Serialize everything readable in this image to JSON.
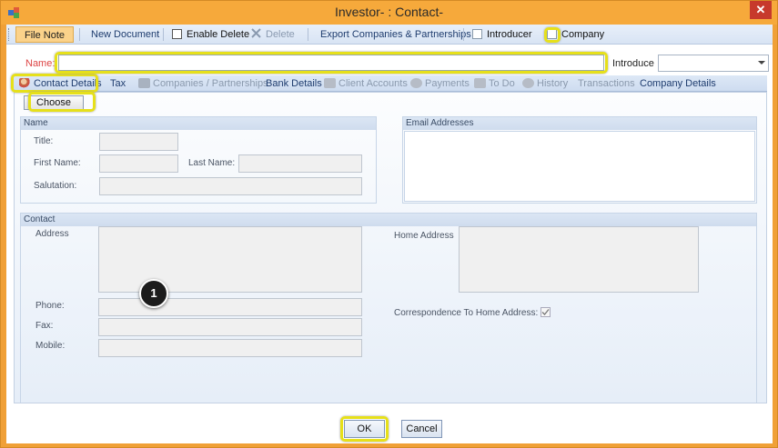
{
  "window": {
    "title": "Investor- : Contact-",
    "close_symbol": "✕"
  },
  "toolbar": {
    "file_note": "File Note",
    "new_document": "New Document",
    "enable_delete": "Enable Delete",
    "delete": "Delete",
    "export": "Export Companies & Partnerships",
    "introducer": "Introducer",
    "company": "Company"
  },
  "header": {
    "name_label": "Name:",
    "name_value": "",
    "introducer_label": "Introduce",
    "introducer_value": ""
  },
  "tabs": [
    "Contact Details",
    "Tax",
    "Companies / Partnerships",
    "Bank Details",
    "Client Accounts",
    "Payments",
    "To Do",
    "History",
    "Transactions",
    "Company Details"
  ],
  "panel": {
    "choose_label": "Choose",
    "name_group": {
      "title": "Name",
      "title_label": "Title:",
      "first_name_label": "First Name:",
      "last_name_label": "Last Name:",
      "salutation_label": "Salutation:"
    },
    "email_group": {
      "title": "Email Addresses"
    },
    "contact_group": {
      "title": "Contact",
      "address_label": "Address",
      "home_address_label": "Home Address",
      "phone_label": "Phone:",
      "fax_label": "Fax:",
      "mobile_label": "Mobile:",
      "correspondence_label": "Correspondence To Home Address:",
      "correspondence_checked": true
    }
  },
  "marker": "1",
  "footer": {
    "ok": "OK",
    "cancel": "Cancel"
  },
  "colors": {
    "titlebar": "#f6a93b",
    "highlight": "#e6e01a",
    "accent": "#1e3c6e"
  }
}
